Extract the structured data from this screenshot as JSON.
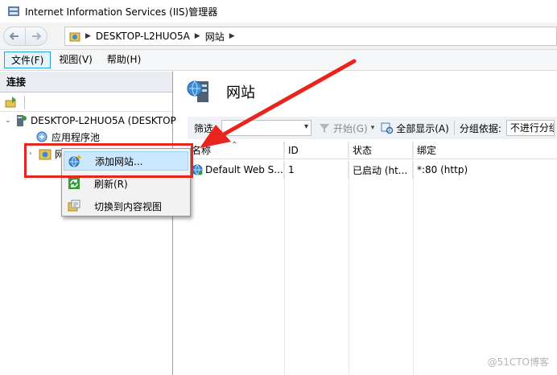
{
  "window": {
    "title": "Internet Information Services (IIS)管理器"
  },
  "address": {
    "segments": [
      "DESKTOP-L2HUO5A",
      "网站"
    ]
  },
  "menu": [
    {
      "label": "文件(F)"
    },
    {
      "label": "视图(V)"
    },
    {
      "label": "帮助(H)"
    }
  ],
  "connections": {
    "header": "连接",
    "tree": {
      "server": "DESKTOP-L2HUO5A (DESKTOP",
      "app_pools": "应用程序池",
      "sites": "网站"
    }
  },
  "content": {
    "title": "网站",
    "filter_label": "筛选:",
    "start_label": "开始(G)",
    "show_all_label": "全部显示(A)",
    "group_by_label": "分组依据:",
    "group_by_value": "不进行分组",
    "columns": [
      "名称",
      "ID",
      "状态",
      "绑定"
    ],
    "rows": [
      {
        "name": "Default Web S...",
        "id": "1",
        "status": "已启动 (ht...",
        "binding": "*:80 (http)"
      }
    ]
  },
  "context_menu": {
    "items": [
      {
        "label": "添加网站..."
      },
      {
        "label": "刷新(R)"
      },
      {
        "label": "切换到内容视图"
      }
    ]
  },
  "watermark": "@51CTO博客",
  "colors": {
    "annotation": "#e8241c",
    "menu_highlight": "#cce8ff"
  }
}
